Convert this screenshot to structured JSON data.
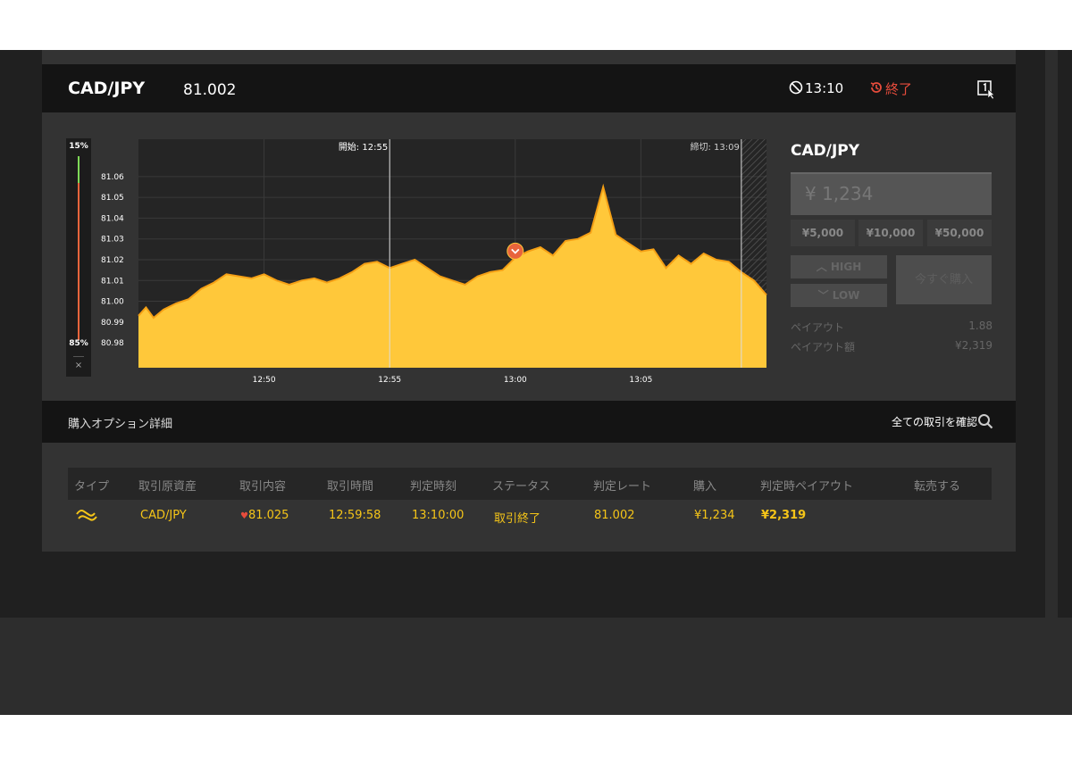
{
  "header": {
    "pair": "CAD/JPY",
    "rate": "81.002",
    "clock_time": "13:10",
    "end_label": "終了"
  },
  "sentiment": {
    "top": "15%",
    "bottom": "85%",
    "close": "×"
  },
  "chart_data": {
    "type": "area",
    "color": "#ffc83a",
    "y_ticks": [
      "81.06",
      "81.05",
      "81.04",
      "81.03",
      "81.02",
      "81.01",
      "81.00",
      "80.99",
      "80.98"
    ],
    "x_ticks": [
      "12:50",
      "12:55",
      "13:00",
      "13:05"
    ],
    "ylim": [
      80.968,
      81.078
    ],
    "start_label": "開始: 12:55",
    "end_label": "締切: 13:09",
    "entry_marker": {
      "time": "12:59:58",
      "rate": 81.025
    },
    "x_minutes": [
      0,
      0.3,
      0.6,
      1,
      1.5,
      2,
      2.5,
      3,
      3.5,
      4,
      4.5,
      5,
      5.5,
      6,
      6.5,
      7,
      7.5,
      8,
      8.5,
      9,
      9.5,
      10,
      10.5,
      11,
      11.5,
      12,
      12.5,
      13,
      13.5,
      14,
      14.5,
      15,
      15.5,
      16,
      16.5,
      17,
      17.5,
      18,
      18.5,
      19,
      19.5,
      20,
      20.5,
      21,
      21.5,
      22,
      22.5,
      23,
      23.5,
      24,
      24.5,
      25
    ],
    "values": [
      80.993,
      80.997,
      80.992,
      80.996,
      80.999,
      81.001,
      81.006,
      81.009,
      81.013,
      81.012,
      81.011,
      81.013,
      81.01,
      81.008,
      81.01,
      81.011,
      81.009,
      81.011,
      81.014,
      81.018,
      81.019,
      81.016,
      81.018,
      81.02,
      81.016,
      81.012,
      81.01,
      81.008,
      81.012,
      81.014,
      81.015,
      81.021,
      81.024,
      81.026,
      81.022,
      81.029,
      81.03,
      81.033,
      81.055,
      81.032,
      81.028,
      81.024,
      81.025,
      81.016,
      81.022,
      81.018,
      81.023,
      81.02,
      81.019,
      81.014,
      81.01,
      81.003
    ]
  },
  "side": {
    "title": "CAD/JPY",
    "amount": "¥ 1,234",
    "quick": [
      "¥5,000",
      "¥10,000",
      "¥50,000"
    ],
    "high": "HIGH",
    "low": "LOW",
    "buy_now": "今すぐ購入",
    "payout_label": "ペイアウト",
    "payout_value": "1.88",
    "payout_amount_label": "ペイアウト額",
    "payout_amount_value": "¥2,319"
  },
  "detail": {
    "title": "購入オプション詳細",
    "confirm": "全ての取引を確認"
  },
  "table": {
    "headers": [
      "タイプ",
      "取引原資産",
      "取引内容",
      "取引時間",
      "判定時刻",
      "ステータス",
      "判定レート",
      "購入",
      "判定時ペイアウト",
      "転売する"
    ],
    "row": {
      "asset": "CAD/JPY",
      "content": "81.025",
      "trade_time": "12:59:58",
      "judge_time": "13:10:00",
      "status": "取引終了",
      "judge_rate": "81.002",
      "purchase": "¥1,234",
      "payout": "¥2,319"
    }
  }
}
